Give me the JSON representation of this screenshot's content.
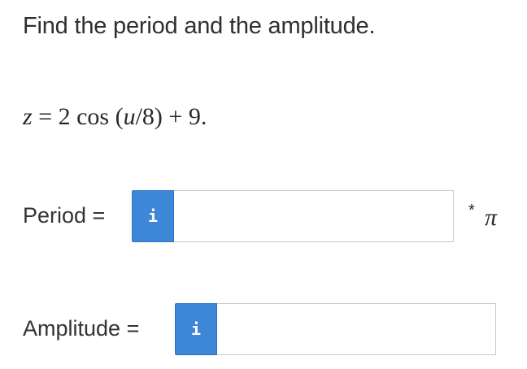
{
  "prompt": "Find the period and the amplitude.",
  "equation": {
    "lhs_var": "z",
    "equals": " = ",
    "coefficient": "2 cos (",
    "arg_var": "u",
    "arg_rest": "/8) + 9."
  },
  "period": {
    "label": "Period =",
    "info_icon": "i",
    "input_value": "",
    "unit_multiplier": "*",
    "unit_symbol": "π"
  },
  "amplitude": {
    "label": "Amplitude =",
    "info_icon": "i",
    "input_value": ""
  },
  "colors": {
    "info_button": "#3e86d8",
    "input_border": "#c9c9c9",
    "text": "#2f2f2f"
  }
}
